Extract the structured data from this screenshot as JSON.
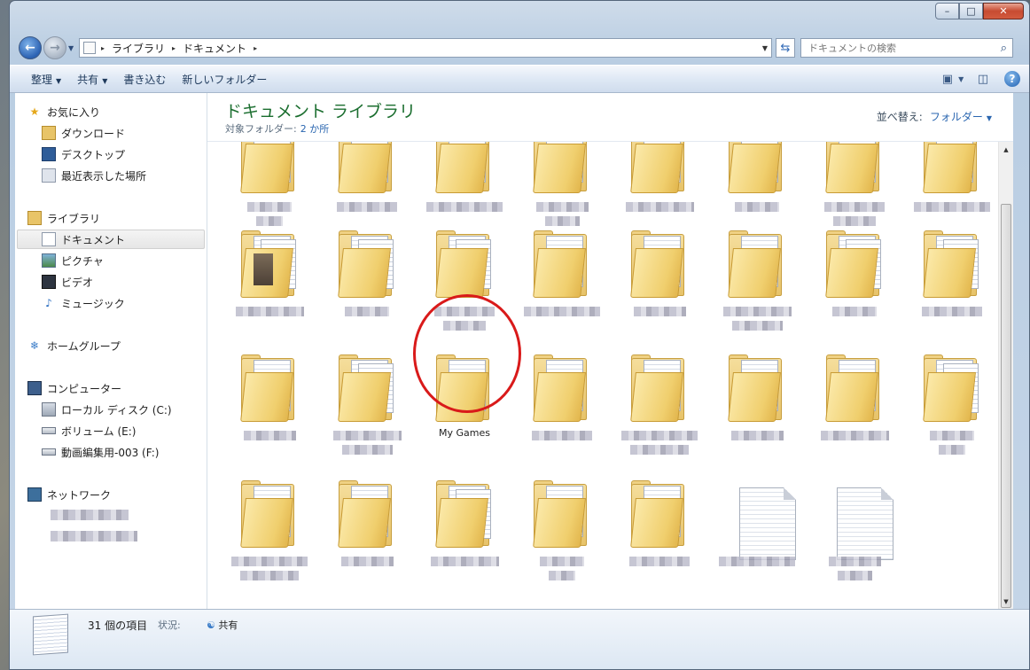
{
  "window": {
    "minimize_glyph": "–",
    "maximize_glyph": "□",
    "close_glyph": "✕"
  },
  "address": {
    "crumbs": [
      "ライブラリ",
      "ドキュメント"
    ],
    "sep": "▸",
    "dropdown_glyph": "▼",
    "search_placeholder": "ドキュメントの検索"
  },
  "toolbar": {
    "organize": "整理",
    "share": "共有",
    "burn": "書き込む",
    "new_folder": "新しいフォルダー",
    "arrow": "▼"
  },
  "sidebar": {
    "favorites": "お気に入り",
    "downloads": "ダウンロード",
    "desktop": "デスクトップ",
    "recent": "最近表示した場所",
    "libraries": "ライブラリ",
    "documents": "ドキュメント",
    "pictures": "ピクチャ",
    "videos": "ビデオ",
    "music": "ミュージック",
    "homegroup": "ホームグループ",
    "computer": "コンピューター",
    "local_disk": "ローカル ディスク (C:)",
    "volume_e": "ボリューム (E:)",
    "volume_f": "動画編集用-003 (F:)",
    "network": "ネットワーク"
  },
  "main": {
    "title": "ドキュメント ライブラリ",
    "subtitle_label": "対象フォルダー:",
    "subtitle_value": "2 か所",
    "sort_label": "並べ替え:",
    "sort_value": "フォルダー",
    "highlighted_item": "My Games"
  },
  "status": {
    "count": "31 個の項目",
    "state_label": "状況:",
    "state_value": "共有"
  },
  "icons": {
    "back": "←",
    "forward": "→",
    "refresh": "⇆",
    "search": "⌕",
    "help": "?",
    "star": "★",
    "scroll_up": "▲",
    "scroll_down": "▼"
  }
}
